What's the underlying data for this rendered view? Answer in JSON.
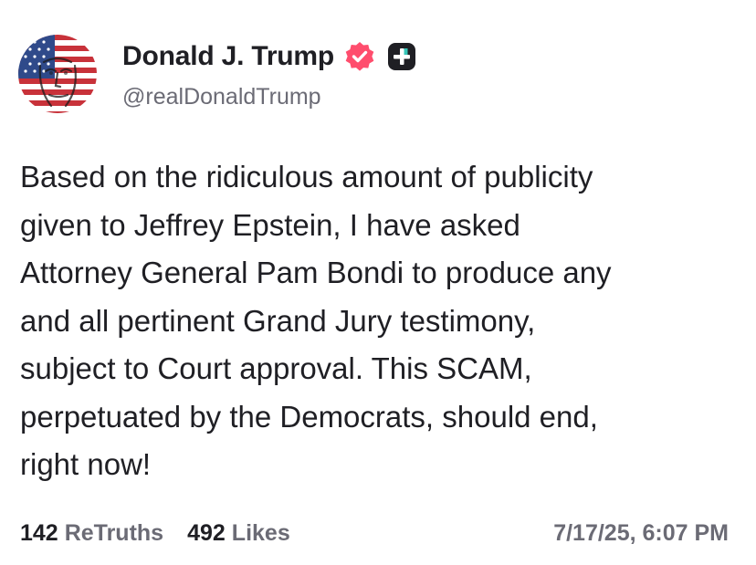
{
  "author": {
    "display_name": "Donald J. Trump",
    "handle": "@realDonaldTrump",
    "avatar_icon": "flag-face-avatar",
    "verified_icon": "verified-badge-icon",
    "verified_color": "#ff4d6d",
    "plus_icon": "plus-badge-icon"
  },
  "post": {
    "text": "Based on the ridiculous amount of publicity\ngiven to Jeffrey Epstein, I have asked\nAttorney General Pam Bondi to produce any\nand all pertinent Grand Jury testimony,\nsubject to Court approval. This SCAM,\nperpetuated by the Democrats, should end,\nright now!"
  },
  "stats": {
    "retruths_count": "142",
    "retruths_label": "ReTruths",
    "likes_count": "492",
    "likes_label": "Likes"
  },
  "timestamp": "7/17/25, 6:07 PM"
}
